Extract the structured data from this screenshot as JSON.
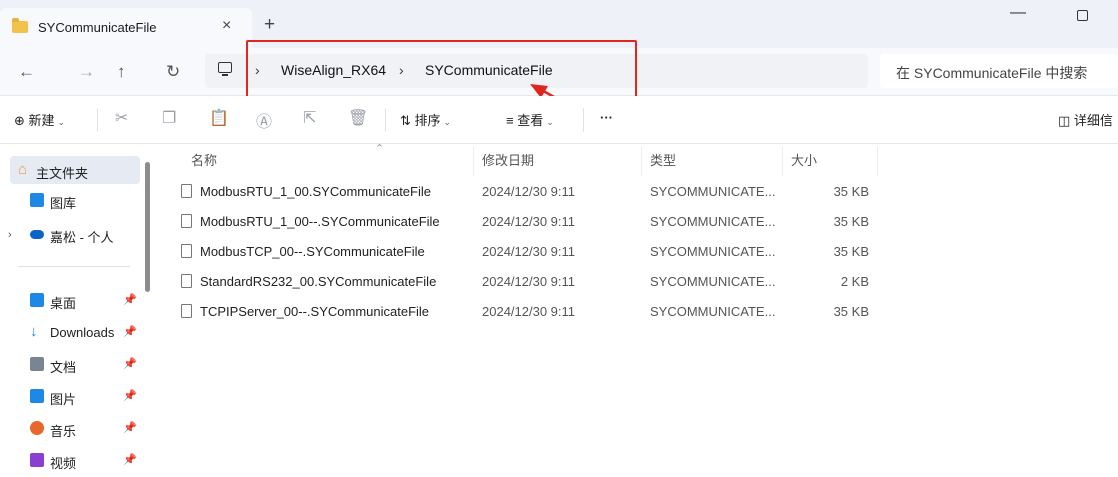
{
  "tab": {
    "title": "SYCommunicateFile",
    "close": "×",
    "new_tab": "+"
  },
  "window": {
    "minimize": "—"
  },
  "nav": {
    "back": "←",
    "forward": "→",
    "up": "↑",
    "refresh": "↻"
  },
  "breadcrumb": {
    "sep": "›",
    "items": [
      "WiseAlign_RX64",
      "SYCommunicateFile"
    ]
  },
  "search": {
    "placeholder": "在 SYCommunicateFile 中搜索"
  },
  "toolbar": {
    "new_label": "新建",
    "sort_label": "排序",
    "view_label": "查看",
    "more": "···",
    "details_label": "详细信"
  },
  "sidebar": {
    "home": "主文件夹",
    "gallery": "图库",
    "onedrive": "嘉松 - 个人",
    "quick": [
      {
        "label": "桌面",
        "icon": "desktop-icon",
        "color": "#1e88e5"
      },
      {
        "label": "Downloads",
        "icon": "download-icon",
        "color": "#1e88e5"
      },
      {
        "label": "文档",
        "icon": "documents-icon",
        "color": "#7a8593"
      },
      {
        "label": "图片",
        "icon": "pictures-icon",
        "color": "#1e88e5"
      },
      {
        "label": "音乐",
        "icon": "music-icon",
        "color": "#e8672a"
      },
      {
        "label": "视频",
        "icon": "videos-icon",
        "color": "#8a3fd1"
      }
    ]
  },
  "columns": {
    "name": "名称",
    "date": "修改日期",
    "type": "类型",
    "size": "大小"
  },
  "files": [
    {
      "name": "ModbusRTU_1_00.SYCommunicateFile",
      "date": "2024/12/30 9:11",
      "type": "SYCOMMUNICATE...",
      "size": "35 KB"
    },
    {
      "name": "ModbusRTU_1_00--.SYCommunicateFile",
      "date": "2024/12/30 9:11",
      "type": "SYCOMMUNICATE...",
      "size": "35 KB"
    },
    {
      "name": "ModbusTCP_00--.SYCommunicateFile",
      "date": "2024/12/30 9:11",
      "type": "SYCOMMUNICATE...",
      "size": "35 KB"
    },
    {
      "name": "StandardRS232_00.SYCommunicateFile",
      "date": "2024/12/30 9:11",
      "type": "SYCOMMUNICATE...",
      "size": "2 KB"
    },
    {
      "name": "TCPIPServer_00--.SYCommunicateFile",
      "date": "2024/12/30 9:11",
      "type": "SYCOMMUNICATE...",
      "size": "35 KB"
    }
  ],
  "annotation_color": "#e0271f"
}
